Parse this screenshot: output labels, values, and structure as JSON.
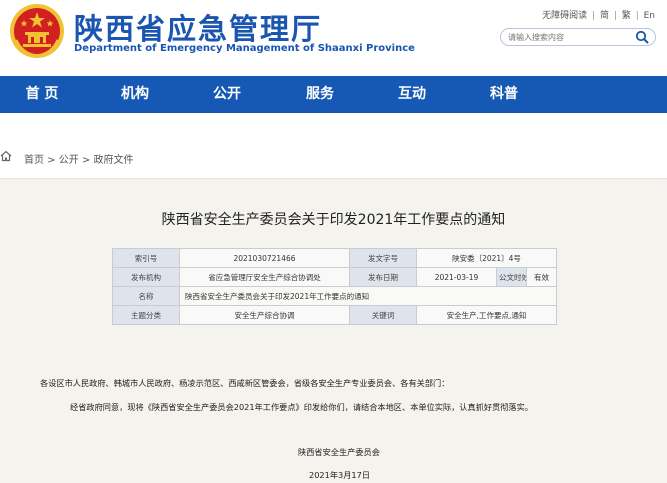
{
  "header": {
    "title": "陕西省应急管理厅",
    "subtitle": "Department of Emergency Management of Shaanxi Province",
    "top_links": {
      "accessibility": "无障碍阅读",
      "simplified": "简",
      "traditional": "繁",
      "english": "En"
    },
    "search": {
      "placeholder": "请输入搜索内容"
    },
    "colors": {
      "brand_blue": "#1a56b0",
      "emblem_red": "#d21f1f",
      "emblem_gold": "#f1c232"
    }
  },
  "nav": {
    "items": [
      "首 页",
      "机构",
      "公开",
      "服务",
      "互动",
      "科普"
    ],
    "background": "#1659b5"
  },
  "breadcrumb": {
    "home": "首页",
    "sep": " > ",
    "level1": "公开",
    "level2": "政府文件"
  },
  "document": {
    "title": "陕西省安全生产委员会关于印发2021年工作要点的通知",
    "meta": {
      "index_label": "索引号",
      "index_value": "2021030721466",
      "doc_no_label": "发文字号",
      "doc_no_value": "陕安委〔2021〕4号",
      "issuer_label": "发布机构",
      "issuer_value": "省应急管理厅安全生产综合协调处",
      "date_label": "发布日期",
      "date_value": "2021-03-19",
      "validity_label": "公文时效",
      "validity_value": "有效",
      "name_label": "名称",
      "name_value": "陕西省安全生产委员会关于印发2021年工作要点的通知",
      "category_label": "主题分类",
      "category_value": "安全生产综合协调",
      "keyword_label": "关键词",
      "keyword_value": "安全生产,工作要点,通知"
    },
    "addressee": "各设区市人民政府、韩城市人民政府、杨凌示范区、西咸新区管委会，省级各安全生产专业委员会、各有关部门：",
    "body": "经省政府同意，现将《陕西省安全生产委员会2021年工作要点》印发给你们，请结合本地区、本单位实际，认真抓好贯彻落实。",
    "signature": "陕西省安全生产委员会",
    "sign_date": "2021年3月17日"
  }
}
